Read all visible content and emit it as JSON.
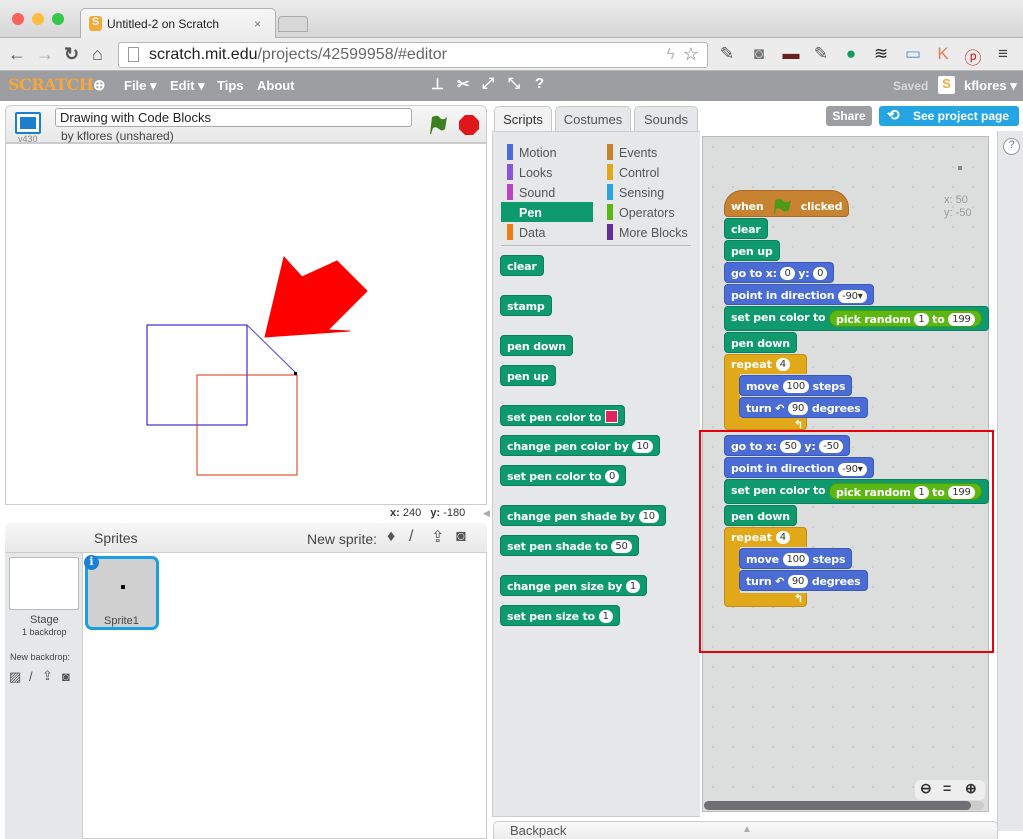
{
  "browser": {
    "tab_title": "Untitled-2 on Scratch",
    "tab_close": "×",
    "url_host": "scratch.mit.edu",
    "url_path": "/projects/42599958/#editor"
  },
  "menu": {
    "logo": "SCRATCH",
    "file": "File ▾",
    "edit": "Edit ▾",
    "tips": "Tips",
    "about": "About",
    "saved": "Saved",
    "user": "kflores ▾"
  },
  "stage": {
    "version": "v430",
    "project_title": "Drawing with Code Blocks",
    "byline": "by kflores (unshared)",
    "coords_x_label": "x:",
    "coords_x": "240",
    "coords_y_label": "y:",
    "coords_y": "-180"
  },
  "sprites": {
    "header": "Sprites",
    "new_sprite": "New sprite:",
    "stage_label": "Stage",
    "stage_sub": "1 backdrop",
    "new_backdrop": "New backdrop:",
    "sprite_name": "Sprite1"
  },
  "editor": {
    "tabs": [
      "Scripts",
      "Costumes",
      "Sounds"
    ],
    "share": "Share",
    "see_project": "See project page",
    "backpack": "Backpack",
    "sprite_x": "x: 50",
    "sprite_y": "y: -50"
  },
  "categories": [
    {
      "label": "Motion",
      "color": "#4a6cd4"
    },
    {
      "label": "Looks",
      "color": "#8a55d7"
    },
    {
      "label": "Sound",
      "color": "#bb42c3"
    },
    {
      "label": "Pen",
      "color": "#0e9a6c"
    },
    {
      "label": "Data",
      "color": "#ee7d16"
    },
    {
      "label": "Events",
      "color": "#c88330"
    },
    {
      "label": "Control",
      "color": "#e1a91a"
    },
    {
      "label": "Sensing",
      "color": "#2ca5e2"
    },
    {
      "label": "Operators",
      "color": "#5cb712"
    },
    {
      "label": "More Blocks",
      "color": "#632d99"
    }
  ],
  "palette": {
    "clear": "clear",
    "stamp": "stamp",
    "pen_down": "pen down",
    "pen_up": "pen up",
    "set_pen_color": "set pen color to",
    "change_pen_color": "change pen color by",
    "change_pen_color_val": "10",
    "set_pen_color_num": "set pen color to",
    "set_pen_color_num_val": "0",
    "change_pen_shade": "change pen shade by",
    "change_pen_shade_val": "10",
    "set_pen_shade": "set pen shade to",
    "set_pen_shade_val": "50",
    "change_pen_size": "change pen size by",
    "change_pen_size_val": "1",
    "set_pen_size": "set pen size to",
    "set_pen_size_val": "1"
  },
  "script": {
    "when": "when",
    "clicked": "clicked",
    "clear": "clear",
    "pen_up": "pen up",
    "goto": "go to x:",
    "y": "y:",
    "goto1_x": "0",
    "goto1_y": "0",
    "point": "point in direction",
    "dir": "-90▾",
    "set_color": "set pen color to",
    "pick_random": "pick random",
    "to": "to",
    "rand_min": "1",
    "rand_max": "199",
    "pen_down": "pen down",
    "repeat": "repeat",
    "repeat_n": "4",
    "move": "move",
    "steps": "steps",
    "move_n": "100",
    "turn": "turn ↶",
    "turn_n": "90",
    "degrees": "degrees",
    "goto2_x": "50",
    "goto2_y": "-50",
    "loop_arrow": "↰"
  }
}
